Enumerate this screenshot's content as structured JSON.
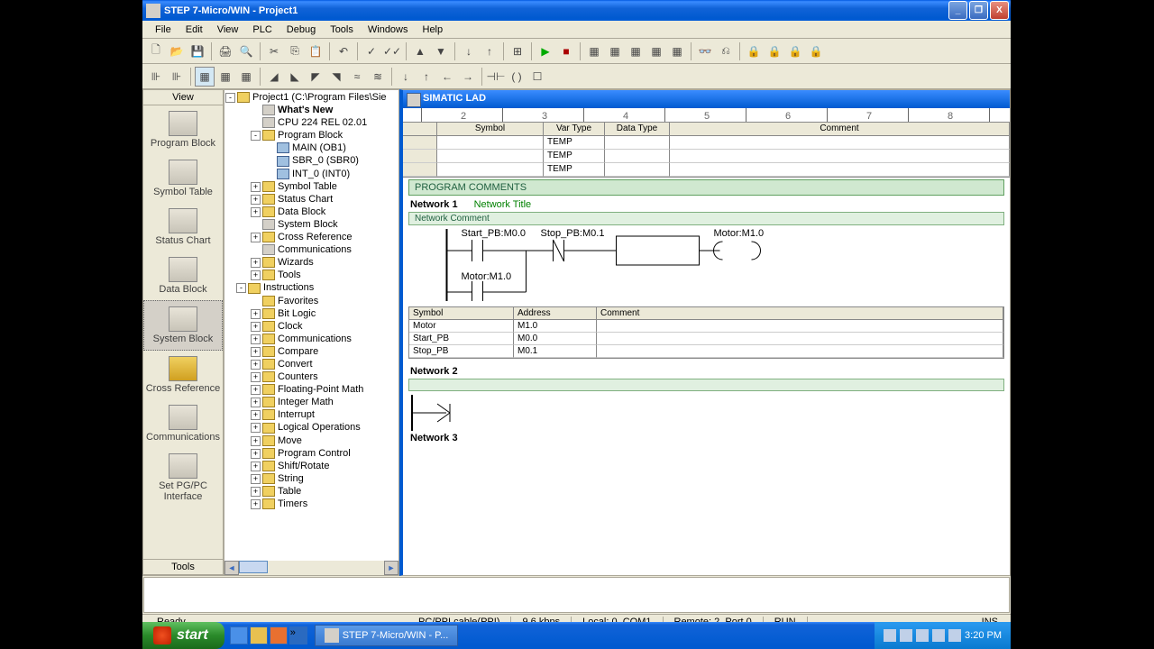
{
  "title": "STEP 7-Micro/WIN - Project1",
  "menu": [
    "File",
    "Edit",
    "View",
    "PLC",
    "Debug",
    "Tools",
    "Windows",
    "Help"
  ],
  "view_pane": {
    "header": "View",
    "items": [
      "Program Block",
      "Symbol Table",
      "Status Chart",
      "Data Block",
      "System Block",
      "Cross Reference",
      "Communications",
      "Set PG/PC Interface"
    ],
    "footer": "Tools"
  },
  "tree": {
    "root": "Project1 (C:\\Program Files\\Sie",
    "items": [
      {
        "l": 1,
        "exp": "",
        "icon": "gray",
        "label": "What's New",
        "bold": true
      },
      {
        "l": 1,
        "exp": "",
        "icon": "gray",
        "label": "CPU 224 REL 02.01"
      },
      {
        "l": 1,
        "exp": "-",
        "icon": "yellow",
        "label": "Program Block"
      },
      {
        "l": 2,
        "exp": "",
        "icon": "blue",
        "label": "MAIN (OB1)"
      },
      {
        "l": 2,
        "exp": "",
        "icon": "blue",
        "label": "SBR_0 (SBR0)"
      },
      {
        "l": 2,
        "exp": "",
        "icon": "blue",
        "label": "INT_0 (INT0)"
      },
      {
        "l": 1,
        "exp": "+",
        "icon": "yellow",
        "label": "Symbol Table"
      },
      {
        "l": 1,
        "exp": "+",
        "icon": "yellow",
        "label": "Status Chart"
      },
      {
        "l": 1,
        "exp": "+",
        "icon": "yellow",
        "label": "Data Block"
      },
      {
        "l": 1,
        "exp": "",
        "icon": "gray",
        "label": "System Block"
      },
      {
        "l": 1,
        "exp": "+",
        "icon": "yellow",
        "label": "Cross Reference"
      },
      {
        "l": 1,
        "exp": "",
        "icon": "gray",
        "label": "Communications"
      },
      {
        "l": 1,
        "exp": "+",
        "icon": "yellow",
        "label": "Wizards"
      },
      {
        "l": 1,
        "exp": "+",
        "icon": "yellow",
        "label": "Tools"
      },
      {
        "l": 0,
        "exp": "-",
        "icon": "yellow",
        "label": "Instructions"
      },
      {
        "l": 1,
        "exp": "",
        "icon": "yellow",
        "label": "Favorites"
      },
      {
        "l": 1,
        "exp": "+",
        "icon": "yellow",
        "label": "Bit Logic"
      },
      {
        "l": 1,
        "exp": "+",
        "icon": "yellow",
        "label": "Clock"
      },
      {
        "l": 1,
        "exp": "+",
        "icon": "yellow",
        "label": "Communications"
      },
      {
        "l": 1,
        "exp": "+",
        "icon": "yellow",
        "label": "Compare"
      },
      {
        "l": 1,
        "exp": "+",
        "icon": "yellow",
        "label": "Convert"
      },
      {
        "l": 1,
        "exp": "+",
        "icon": "yellow",
        "label": "Counters"
      },
      {
        "l": 1,
        "exp": "+",
        "icon": "yellow",
        "label": "Floating-Point Math"
      },
      {
        "l": 1,
        "exp": "+",
        "icon": "yellow",
        "label": "Integer Math"
      },
      {
        "l": 1,
        "exp": "+",
        "icon": "yellow",
        "label": "Interrupt"
      },
      {
        "l": 1,
        "exp": "+",
        "icon": "yellow",
        "label": "Logical Operations"
      },
      {
        "l": 1,
        "exp": "+",
        "icon": "yellow",
        "label": "Move"
      },
      {
        "l": 1,
        "exp": "+",
        "icon": "yellow",
        "label": "Program Control"
      },
      {
        "l": 1,
        "exp": "+",
        "icon": "yellow",
        "label": "Shift/Rotate"
      },
      {
        "l": 1,
        "exp": "+",
        "icon": "yellow",
        "label": "String"
      },
      {
        "l": 1,
        "exp": "+",
        "icon": "yellow",
        "label": "Table"
      },
      {
        "l": 1,
        "exp": "+",
        "icon": "yellow",
        "label": "Timers"
      }
    ]
  },
  "editor": {
    "title": "SIMATIC LAD",
    "var_headers": [
      "Symbol",
      "Var Type",
      "Data Type",
      "Comment"
    ],
    "var_rows": [
      {
        "sym": "",
        "vt": "TEMP",
        "dt": "",
        "cm": ""
      },
      {
        "sym": "",
        "vt": "TEMP",
        "dt": "",
        "cm": ""
      },
      {
        "sym": "",
        "vt": "TEMP",
        "dt": "",
        "cm": ""
      }
    ],
    "prog_comments": "PROGRAM COMMENTS",
    "net1": {
      "hdr": "Network 1",
      "title": "Network Title",
      "comment": "Network Comment"
    },
    "contacts": {
      "c1": "Start_PB:M0.0",
      "c2": "Stop_PB:M0.1",
      "coil": "Motor:M1.0",
      "c3": "Motor:M1.0"
    },
    "sym_headers": [
      "Symbol",
      "Address",
      "Comment"
    ],
    "sym_rows": [
      {
        "s": "Motor",
        "a": "M1.0",
        "c": ""
      },
      {
        "s": "Start_PB",
        "a": "M0.0",
        "c": ""
      },
      {
        "s": "Stop_PB",
        "a": "M0.1",
        "c": ""
      }
    ],
    "net2": "Network 2",
    "net3": "Network 3"
  },
  "status": {
    "ready": "Ready",
    "cable": "PC/PPI cable(PPI)",
    "baud": "9.6 kbps",
    "local": "Local: 0, COM1",
    "remote": "Remote: 2, Port 0",
    "run": "RUN",
    "ins": "INS"
  },
  "taskbar": {
    "start": "start",
    "task": "STEP 7-Micro/WIN - P...",
    "time": "3:20 PM"
  }
}
